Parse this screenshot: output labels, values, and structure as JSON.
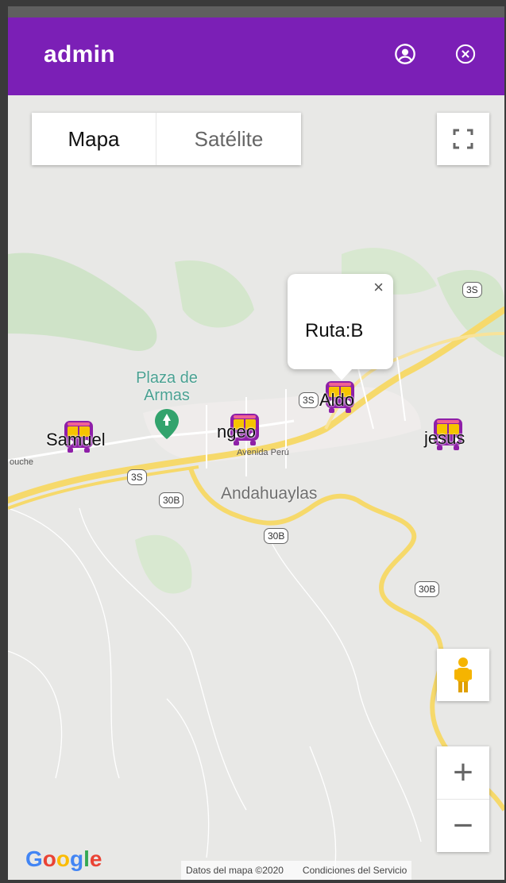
{
  "appbar": {
    "title": "admin",
    "icons": [
      "account-circle-icon",
      "close-circle-icon"
    ]
  },
  "colors": {
    "appbar": "#7b1fb6",
    "bus": "#8e1fa8",
    "road": "#f6d96b"
  },
  "map": {
    "type_control": {
      "map_label": "Mapa",
      "satellite_label": "Satélite",
      "selected": "Mapa"
    },
    "popup": {
      "close": "×",
      "text": "Ruta:B"
    },
    "buses": [
      {
        "label": "Samuel"
      },
      {
        "label": "ngeo"
      },
      {
        "label": "Aldo"
      },
      {
        "label": "jesus"
      }
    ],
    "places": {
      "plaza": "Plaza de Armas",
      "city": "Andahuaylas",
      "street": "Avenida Perú",
      "left_edge": "ouche"
    },
    "shields": [
      "3S",
      "3S",
      "3S",
      "30B",
      "30B",
      "30B"
    ],
    "zoom": {
      "in": "+",
      "out": "−"
    },
    "logo": "Google",
    "attribution": {
      "data": "Datos del mapa ©2020",
      "terms": "Condiciones del Servicio"
    }
  }
}
